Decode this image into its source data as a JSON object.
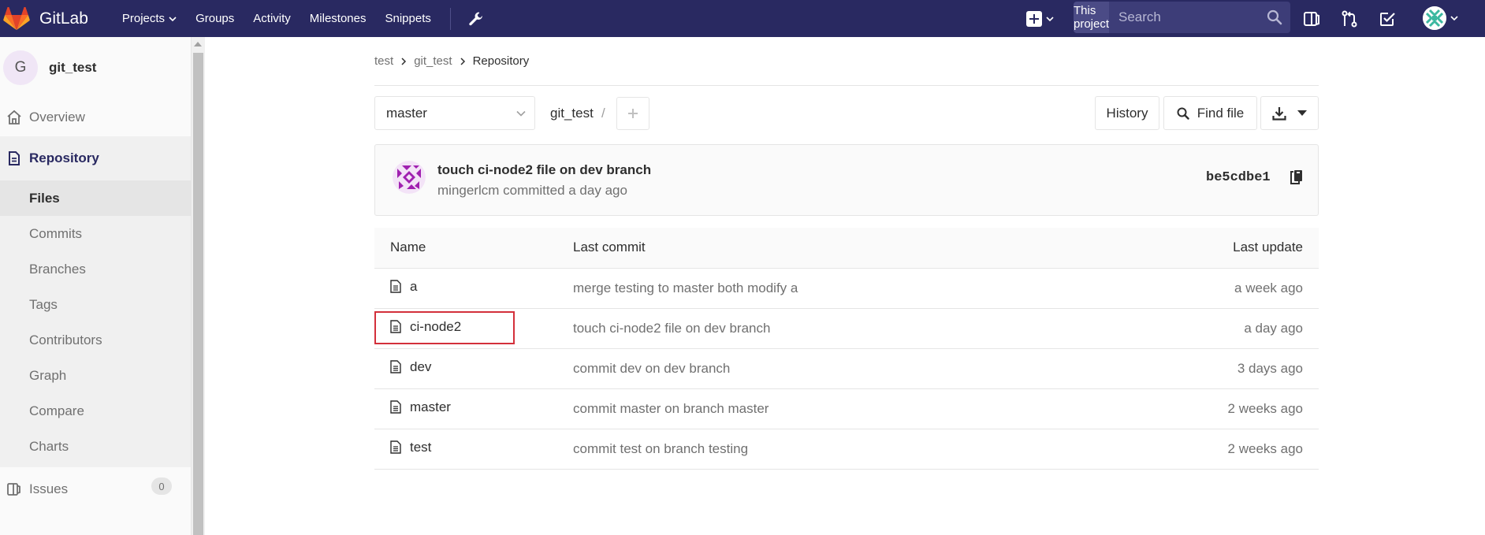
{
  "navbar": {
    "brand": "GitLab",
    "links": [
      "Projects",
      "Groups",
      "Activity",
      "Milestones",
      "Snippets"
    ],
    "search_scope": "This project",
    "search_placeholder": "Search"
  },
  "sidebar": {
    "project_initial": "G",
    "project_name": "git_test",
    "overview": "Overview",
    "repository": "Repository",
    "sub_items": [
      "Files",
      "Commits",
      "Branches",
      "Tags",
      "Contributors",
      "Graph",
      "Compare",
      "Charts"
    ],
    "issues": "Issues",
    "issues_count": "0"
  },
  "breadcrumb": [
    "test",
    "git_test",
    "Repository"
  ],
  "controls": {
    "branch": "master",
    "path_root": "git_test",
    "path_separator": "/",
    "history": "History",
    "find_file": "Find file"
  },
  "last_commit": {
    "title": "touch ci-node2 file on dev branch",
    "meta": "mingerlcm committed a day ago",
    "sha": "be5cdbe1"
  },
  "files": {
    "headers": [
      "Name",
      "Last commit",
      "Last update"
    ],
    "rows": [
      {
        "name": "a",
        "commit": "merge testing to master both modify a",
        "updated": "a week ago"
      },
      {
        "name": "ci-node2",
        "commit": "touch ci-node2 file on dev branch",
        "updated": "a day ago"
      },
      {
        "name": "dev",
        "commit": "commit dev on dev branch",
        "updated": "3 days ago"
      },
      {
        "name": "master",
        "commit": "commit master on branch master",
        "updated": "2 weeks ago"
      },
      {
        "name": "test",
        "commit": "commit test on branch testing",
        "updated": "2 weeks ago"
      }
    ]
  },
  "colors": {
    "navbar": "#292961",
    "highlight": "#d3303b"
  }
}
